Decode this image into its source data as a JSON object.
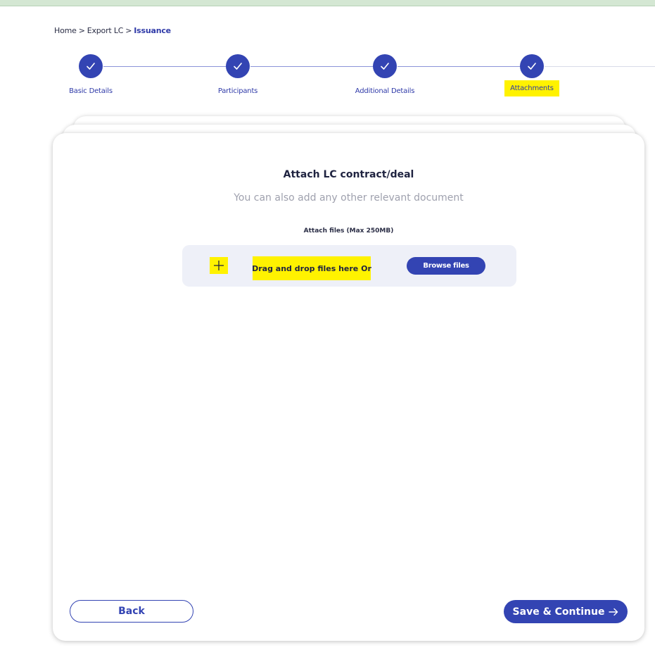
{
  "breadcrumb": {
    "items": [
      "Home",
      "Export LC"
    ],
    "separator": ">",
    "current": "Issuance"
  },
  "stepper": {
    "steps": [
      {
        "label": "Basic Details",
        "status": "complete",
        "icon": "checkmark-icon"
      },
      {
        "label": "Participants",
        "status": "complete",
        "icon": "checkmark-icon"
      },
      {
        "label": "Additional Details",
        "status": "complete",
        "icon": "checkmark-icon"
      },
      {
        "label": "Attachments",
        "status": "complete",
        "icon": "checkmark-icon",
        "highlighted": true
      }
    ]
  },
  "attachment": {
    "title": "Attach LC contract/deal",
    "subtitle": "You can also add any other relevant document",
    "attach_label": "Attach files (Max 250MB)",
    "drop_icon": "plus-icon",
    "drop_text": "Drag and drop files here Or",
    "browse_label": "Browse files"
  },
  "footer": {
    "back_label": "Back",
    "save_label": "Save & Continue",
    "save_icon": "arrow-right-icon"
  },
  "colors": {
    "primary": "#3344b3",
    "highlight": "#fff200",
    "dropzone_bg": "#eef0f8",
    "muted_text": "#9fa1ae"
  }
}
